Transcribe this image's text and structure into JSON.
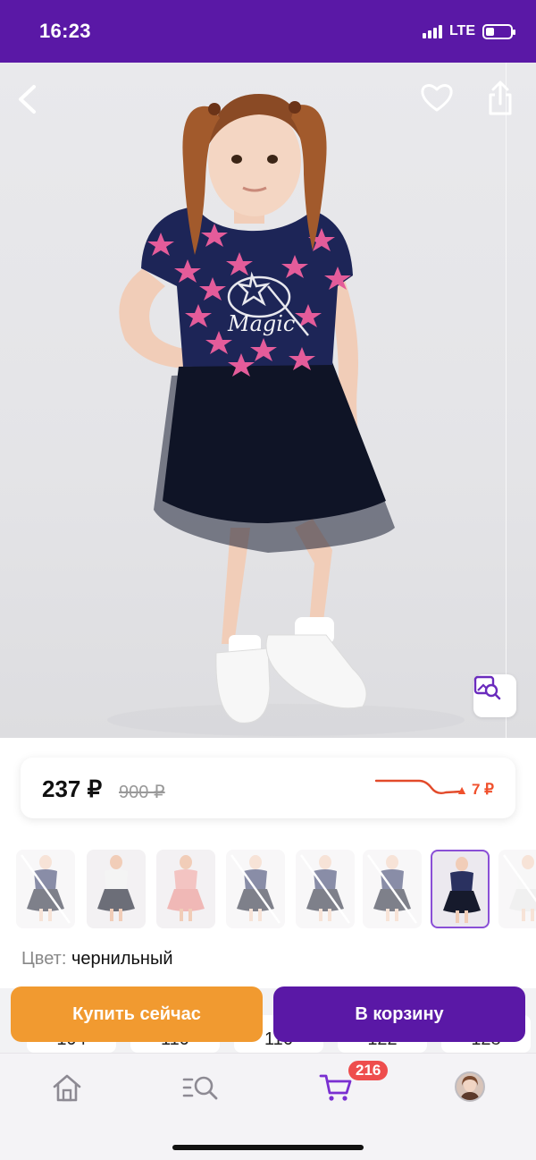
{
  "status_bar": {
    "time": "16:23",
    "network": "LTE",
    "battery_level": 0.35
  },
  "product": {
    "price": "237 ₽",
    "old_price": "900 ₽",
    "price_change": "7 ₽",
    "color_label": "Цвет:",
    "color_value": "чернильный",
    "print_text": "Magic"
  },
  "thumbnails": [
    {
      "variant": "navy-star-dress",
      "state": "unavailable"
    },
    {
      "variant": "white-grey-tutu-dress",
      "state": "available"
    },
    {
      "variant": "pink-tutu-dress",
      "state": "available"
    },
    {
      "variant": "navy-star-dress",
      "state": "unavailable"
    },
    {
      "variant": "navy-star-dress",
      "state": "unavailable"
    },
    {
      "variant": "navy-star-dress",
      "state": "unavailable"
    },
    {
      "variant": "navy-star-dress",
      "state": "selected"
    },
    {
      "variant": "white-dress",
      "state": "unavailable"
    }
  ],
  "sizes": [
    "104",
    "110",
    "116",
    "122",
    "128"
  ],
  "actions": {
    "buy_now": "Купить сейчас",
    "add_to_cart": "В корзину"
  },
  "tabbar": {
    "cart_count": "216"
  },
  "colors": {
    "brand_purple": "#5a18a6",
    "buy_orange": "#f19a30",
    "price_up_red": "#f0502c",
    "badge_red": "#ee4d4d"
  }
}
